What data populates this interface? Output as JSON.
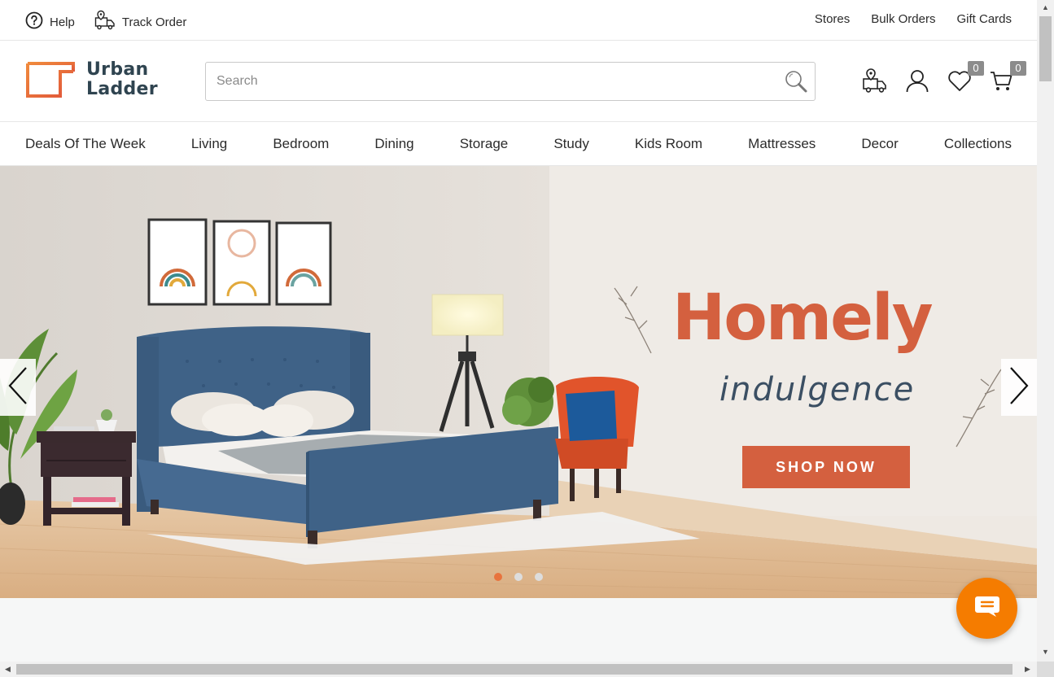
{
  "utility": {
    "help_label": "Help",
    "track_label": "Track Order",
    "stores_label": "Stores",
    "bulk_label": "Bulk Orders",
    "gift_label": "Gift Cards"
  },
  "brand": {
    "line1": "Urban",
    "line2": "Ladder",
    "accent": "#e8733d"
  },
  "search": {
    "placeholder": "Search",
    "value": ""
  },
  "header": {
    "wishlist_count": "0",
    "cart_count": "0"
  },
  "nav": {
    "items": [
      "Deals Of The Week",
      "Living",
      "Bedroom",
      "Dining",
      "Storage",
      "Study",
      "Kids Room",
      "Mattresses",
      "Decor",
      "Collections"
    ]
  },
  "hero": {
    "title": "Homely",
    "subtitle": "indulgence",
    "cta": "SHOP NOW",
    "title_color": "#d4603f",
    "subtitle_color": "#3b4f63",
    "slides": 3,
    "active_slide": 1
  },
  "icons": {
    "help": "help-circle-icon",
    "track": "delivery-truck-icon",
    "search": "magnifier-icon",
    "store": "store-location-icon",
    "account": "user-icon",
    "wishlist": "heart-icon",
    "cart": "cart-icon",
    "chat": "chat-icon"
  }
}
